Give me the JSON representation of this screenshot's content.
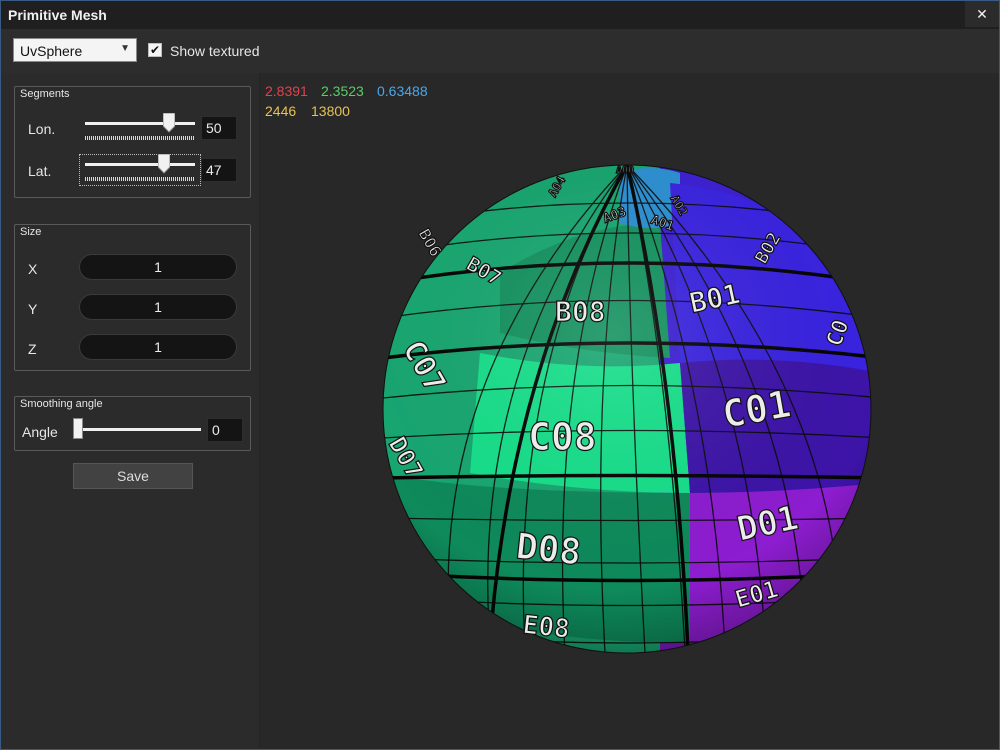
{
  "window": {
    "title": "Primitive Mesh",
    "close_glyph": "✕"
  },
  "toolbar": {
    "mesh_type": "UvSphere",
    "show_textured_label": "Show textured",
    "show_textured_checked": true
  },
  "segments": {
    "title": "Segments",
    "lon_label": "Lon.",
    "lon_value": "50",
    "lat_label": "Lat.",
    "lat_value": "47"
  },
  "size": {
    "title": "Size",
    "x_label": "X",
    "x_value": "1",
    "y_label": "Y",
    "y_value": "1",
    "z_label": "Z",
    "z_value": "1"
  },
  "smoothing": {
    "title": "Smoothing angle",
    "angle_label": "Angle",
    "angle_value": "0"
  },
  "save_label": "Save",
  "stats": {
    "v1": "2.8391",
    "v1_color": "#e0424f",
    "v2": "2.3523",
    "v2_color": "#5ccc66",
    "v3": "0.63488",
    "v3_color": "#4aa7e8",
    "v4": "2446",
    "v4_color": "#e6c257",
    "v5": "13800",
    "v5_color": "#e6c257"
  },
  "texture_labels": {
    "a00": "A00",
    "a01": "A01",
    "a02": "A02",
    "a03": "A03",
    "a04": "A04",
    "b01": "B01",
    "b02": "B02",
    "b06": "B06",
    "b07": "B07",
    "b08": "B08",
    "c01": "C01",
    "c02": "C0",
    "c07": "C07",
    "c08": "C08",
    "d01": "D01",
    "d07": "D07",
    "d08": "D08",
    "e01": "E01",
    "e08": "E08"
  },
  "icons": {
    "checkbox": "checkmark-icon",
    "dropdown": "chevron-down-icon",
    "close": "close-icon"
  }
}
